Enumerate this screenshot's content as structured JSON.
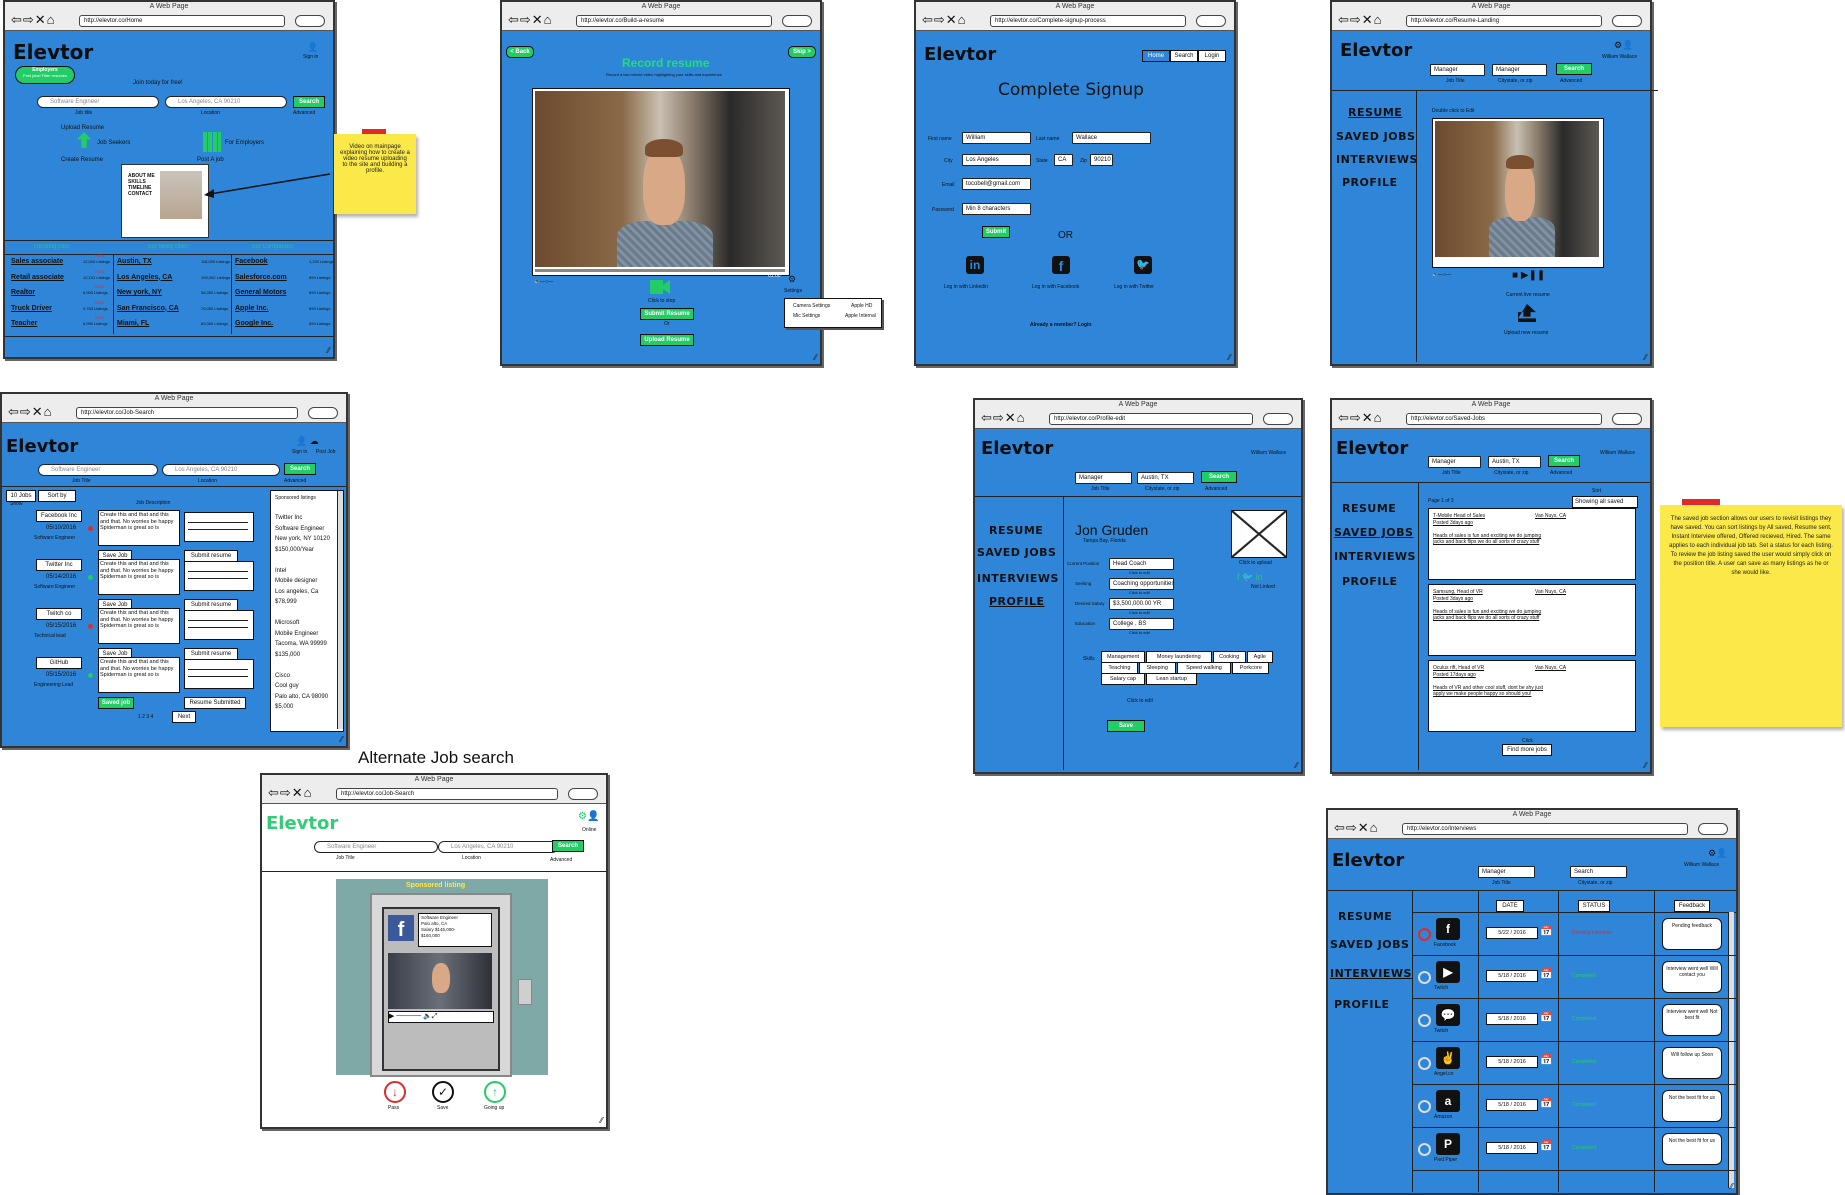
{
  "common": {
    "window_title": "A Web Page",
    "nav_buttons": "⇦⇨✕⌂",
    "logo": "Elevtor",
    "search": "Search",
    "advanced": "Advanced",
    "job_title": "Job Title",
    "location_cap": "Location",
    "citystate": "Citystate, or zip",
    "user": "William Wallace",
    "sign_in": "Sign in",
    "post_job": "Post Job"
  },
  "side_menu": [
    "RESUME",
    "SAVED JOBS",
    "INTERVIEWS",
    "PROFILE"
  ],
  "home": {
    "url": "http://elevtor.co/Home",
    "badge_line1": "Employers",
    "badge_line2": "Post jobs! Filter resumes",
    "join": "Join today for free!",
    "job_placeholder": "Software Engineer",
    "job_caption": "Job title",
    "loc_placeholder": "Los Angeles, CA 90210",
    "upload_resume": "Upload Resume",
    "job_seekers": "Job Seekers",
    "create_resume": "Create Resume",
    "for_employers": "For Employers",
    "post_a_job": "Post A job",
    "headers": [
      "Trending jobs",
      "Top hiring cities",
      "Top Companies"
    ],
    "jobs": [
      [
        "Sales associate",
        "12,000 Listings"
      ],
      [
        "Retail associate",
        "10,101 Listings"
      ],
      [
        "Realtor",
        "8,900 Listings"
      ],
      [
        "Truck Driver",
        "9,783 Listings"
      ],
      [
        "Teacher",
        "6,990 Listings"
      ]
    ],
    "cities": [
      [
        "Austin, TX",
        "118,000 Listings"
      ],
      [
        "Los Angeles, CA",
        "109,000 Listings"
      ],
      [
        "New york, NY",
        "96,000 Listings"
      ],
      [
        "San Francisco, CA",
        "79,000 Listings"
      ],
      [
        "Miami, FL",
        "69,000 Listings"
      ]
    ],
    "companies": [
      [
        "Facebook",
        "1,230 Listings"
      ],
      [
        "Salesforce.com",
        "899 Listings"
      ],
      [
        "General Motors",
        "899 Listings"
      ],
      [
        "Apple Inc.",
        "899 Listings"
      ],
      [
        "Google Inc.",
        "899 Listings"
      ]
    ],
    "new_tag": "NEW",
    "note": "Video on mainpage explaining how to create a video resume uploading to the site and building a profile."
  },
  "record": {
    "url": "http://elevtor.co/Build-a-resume",
    "back": "< Back",
    "skip": "Skip >",
    "title": "Record resume",
    "subtitle": "Record a two minute video highlighting your skills and experience",
    "time": "01:00",
    "click_stop": "Click to stop",
    "submit": "Submit Resume",
    "or": "Or",
    "upload": "Upload Resume",
    "settings": "Settings",
    "menu": [
      [
        "Camera Settings",
        "Apple HD"
      ],
      [
        "Mic Settings",
        "Apple Internal"
      ]
    ]
  },
  "signup": {
    "url": "http://elevtor.co/Complete-signup-process",
    "tabs": [
      "Home",
      "Search",
      "Login"
    ],
    "title": "Complete Signup",
    "first_label": "First name",
    "first": "William",
    "last_label": "Last name",
    "last": "Wallace",
    "city_label": "City",
    "city": "Los Angeles",
    "state_label": "State",
    "state": "CA",
    "zip_label": "Zip",
    "zip": "90210",
    "email_label": "Email",
    "email": "tocobell@gmail.com",
    "password_label": "Password",
    "password": "Min 8 characters",
    "submit": "Submit",
    "or": "OR",
    "li": "Log in with Linkedin",
    "fb": "Log in with Facebook",
    "tw": "Log in with Twitter",
    "member": "Already a member? Login"
  },
  "landing": {
    "url": "http://elevtor.co/Resume-Landing",
    "job_value": "Manager",
    "loc_value": "Manager",
    "dbl": "Double click to Edit",
    "current": "Current live resume",
    "upload": "Upload new resume"
  },
  "jobsearch": {
    "url": "http://elevtor.co/Job-Search",
    "job_placeholder": "Software Engineer",
    "job_caption": "Job Title",
    "loc_placeholder": "Los Angeles, CA 90210",
    "jobs_count": "10 Jobs",
    "sort": "Sort by",
    "show": "Show",
    "desc_header": "Job Description",
    "desc": "Create this and that and this and that. No worries be happy Spiderman is great so is",
    "save_job": "Save Job",
    "submit": "Submit resume",
    "saved": "Saved job",
    "submitted": "Resume Submitted",
    "listings": [
      {
        "company": "Facebook Inc",
        "date": "05/10/2016",
        "role": "Software Engineer"
      },
      {
        "company": "Twitter Inc",
        "date": "05/14/2016",
        "role": "Software Engineer"
      },
      {
        "company": "Twitch co",
        "date": "05/15/2016",
        "role": "Technical lead"
      },
      {
        "company": "GitHub",
        "date": "05/15/2016",
        "role": "Engineering Lead"
      }
    ],
    "pages": "1   2   3   4",
    "next": "Next",
    "sponsored_title": "Sponsored listings",
    "sponsored": [
      "Twitter Inc",
      "Software Engineer",
      "New york, NY 10120",
      "$150,000/Year",
      "",
      "Intel",
      "Mobile designer",
      "Los angeles, Ca",
      "$78,999",
      "",
      "Microsoft",
      "Mobile Engineer",
      "Tacoma, WA 99999",
      "$135,000",
      "",
      "Cisco",
      "Cool guy",
      "Palo alto, CA 98090",
      "$5,000"
    ]
  },
  "alternate": {
    "heading": "Alternate Job search",
    "url": "http://elevtor.co/Job-Search",
    "online": "Online",
    "location_caption": "Location",
    "sponsored": "Sponsored listing",
    "card": [
      "Software Engineer",
      "Palo alto, CA",
      "Salary $145,000-",
      "$160,000"
    ],
    "pass": "Pass",
    "save": "Save",
    "going_up": "Going up"
  },
  "profile": {
    "url": "http://elevtor.co/Profile-edit",
    "job_value": "Manager",
    "loc_value": "Austin, TX",
    "name": "Jon Gruden",
    "place": "Tampa Bay, Florida",
    "upload": "Click to upload",
    "not_linked": "Not Linked",
    "fields": [
      [
        "Current Position",
        "Head Coach"
      ],
      [
        "Seeking",
        "Coaching opportunities"
      ],
      [
        "Desired Salary",
        "$3,500,000.00 YR"
      ],
      [
        "Education",
        "College , BS"
      ]
    ],
    "click_edit": "Click to edit",
    "skills_label": "Skills",
    "skills": [
      "Management",
      "Money laundering",
      "Cooking",
      "Agile",
      "Teaching",
      "Sleeping",
      "Speed walking",
      "Porkcore",
      "Salary cap",
      "Lean startup"
    ],
    "save": "Save"
  },
  "saved": {
    "url": "http://elevtor.co/Saved-Jobs",
    "job_value": "Manager",
    "loc_value": "Austin, TX",
    "page": "Page 1 of 3",
    "sort": "Sort",
    "showing": "Showing all saved",
    "items": [
      {
        "title": "T-Mobile Head of Sales",
        "loc": "Van Nuys, CA",
        "posted": "Posted 3days ago",
        "body": "Heads of sales is fun and exciting we do jumping jacks and back flips we do all sorts of crazy stuff"
      },
      {
        "title": "Samsung, Head of VR",
        "loc": "Van Nuys, CA",
        "posted": "Posted 3days ago",
        "body": "Heads of sales is fun and exciting we do jumping jacks and back flips we do all sorts of crazy stuff"
      },
      {
        "title": "Oculus rift, Head of VR",
        "loc": "Van Nuys, CA",
        "posted": "Posted 17days ago",
        "body": "Heads of VR and other cool stuff, dont be shy just apply we make people happy so should you!"
      }
    ],
    "click": "Click",
    "find_more": "Find more jobs",
    "note": "The saved job section allows our users to revisit listings they have saved. You can sort listings by All saved, Resume sent, Instant Interview offered, Offered recieved, Hired. The same applies to each individual job tab. Set a status for each listing. To review the job listing saved the user would simply click on the position title. A user can save as many listings as he or she would like."
  },
  "interviews": {
    "url": "http://elevtor.co/Interviews",
    "job_value": "Manager",
    "loc_value": "Search",
    "headers": [
      "DATE",
      "STATUS",
      "Feedback"
    ],
    "rows": [
      {
        "company": "Facebook",
        "date": "5/22  /  2016",
        "status": "Pending Interview",
        "feedback": "Pending feedback"
      },
      {
        "company": "Twitch",
        "date": "5/18  /  2016",
        "status": "Completed",
        "feedback": "Interview went well Will contact you"
      },
      {
        "company": "Twitch",
        "date": "5/18  /  2016",
        "status": "Completed",
        "feedback": "Interview went well Not best fit"
      },
      {
        "company": "Angel.co",
        "date": "5/18  /  2016",
        "status": "Completed",
        "feedback": "Will follow up Soon"
      },
      {
        "company": "Amazon",
        "date": "5/18  /  2016",
        "status": "Completed",
        "feedback": "Not the best fit for us"
      },
      {
        "company": "Pied Piper",
        "date": "5/18  /  2016",
        "status": "Completed",
        "feedback": "Not the best fit for us"
      }
    ]
  }
}
